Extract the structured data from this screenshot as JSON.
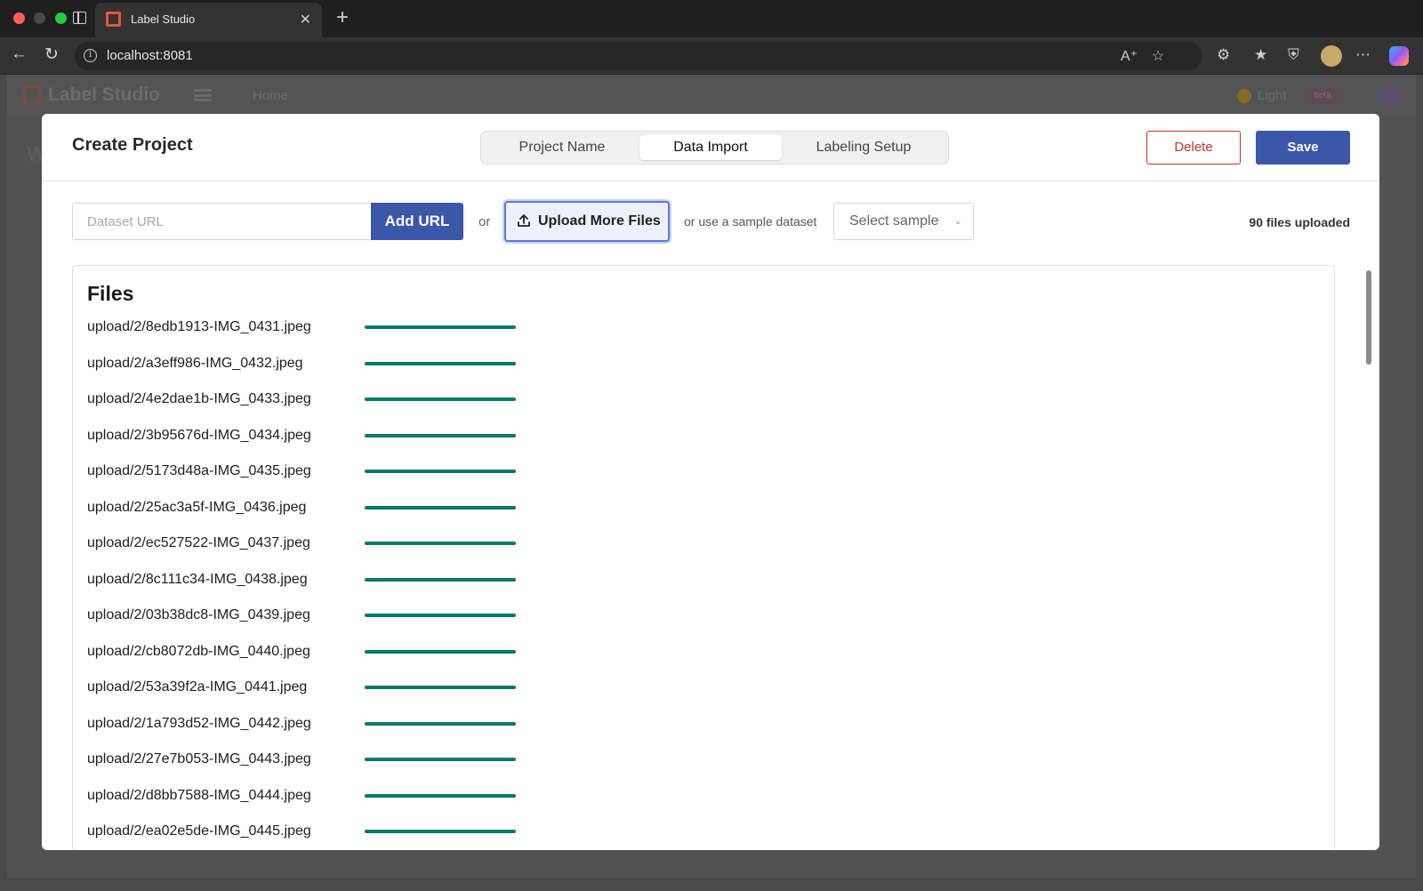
{
  "browser": {
    "tab_title": "Label Studio",
    "tab_close": "✕",
    "new_tab": "+",
    "url": "localhost:8081"
  },
  "background_app": {
    "brand": "Label Studio",
    "nav_home": "Home",
    "theme_label": "Light",
    "beta_badge": "beta",
    "page_heading_initial": "W"
  },
  "modal": {
    "title": "Create Project",
    "steps": [
      {
        "label": "Project Name",
        "active": false
      },
      {
        "label": "Data Import",
        "active": true
      },
      {
        "label": "Labeling Setup",
        "active": false
      }
    ],
    "delete_label": "Delete",
    "save_label": "Save"
  },
  "import": {
    "url_placeholder": "Dataset URL",
    "url_value": "",
    "add_url_label": "Add URL",
    "or_label": "or",
    "upload_label": "Upload More Files",
    "sample_label": "or use a sample dataset",
    "select_sample": "Select sample",
    "files_count": "90 files uploaded"
  },
  "files": {
    "title": "Files",
    "items": [
      {
        "name": "upload/2/8edb1913-IMG_0431.jpeg",
        "progress": 1.0
      },
      {
        "name": "upload/2/a3eff986-IMG_0432.jpeg",
        "progress": 1.0
      },
      {
        "name": "upload/2/4e2dae1b-IMG_0433.jpeg",
        "progress": 1.0
      },
      {
        "name": "upload/2/3b95676d-IMG_0434.jpeg",
        "progress": 1.0
      },
      {
        "name": "upload/2/5173d48a-IMG_0435.jpeg",
        "progress": 1.0
      },
      {
        "name": "upload/2/25ac3a5f-IMG_0436.jpeg",
        "progress": 1.0
      },
      {
        "name": "upload/2/ec527522-IMG_0437.jpeg",
        "progress": 1.0
      },
      {
        "name": "upload/2/8c111c34-IMG_0438.jpeg",
        "progress": 1.0
      },
      {
        "name": "upload/2/03b38dc8-IMG_0439.jpeg",
        "progress": 1.0
      },
      {
        "name": "upload/2/cb8072db-IMG_0440.jpeg",
        "progress": 1.0
      },
      {
        "name": "upload/2/53a39f2a-IMG_0441.jpeg",
        "progress": 1.0
      },
      {
        "name": "upload/2/1a793d52-IMG_0442.jpeg",
        "progress": 1.0
      },
      {
        "name": "upload/2/27e7b053-IMG_0443.jpeg",
        "progress": 1.0
      },
      {
        "name": "upload/2/d8bb7588-IMG_0444.jpeg",
        "progress": 1.0
      },
      {
        "name": "upload/2/ea02e5de-IMG_0445.jpeg",
        "progress": 1.0
      }
    ]
  },
  "colors": {
    "primary": "#3b57a8",
    "danger": "#c0392b",
    "progress": "#0b7a68",
    "upload_border": "#5b7bd5"
  },
  "icons": {
    "back": "arrow-left-icon",
    "reload": "reload-icon",
    "info": "info-icon",
    "read_aloud": "read-aloud-icon",
    "favorite": "star-icon",
    "extensions": "puzzle-icon",
    "favorites": "favorites-icon",
    "shield": "shield-icon",
    "more": "more-icon",
    "upload": "upload-icon",
    "chevron": "chevron-down-icon"
  }
}
